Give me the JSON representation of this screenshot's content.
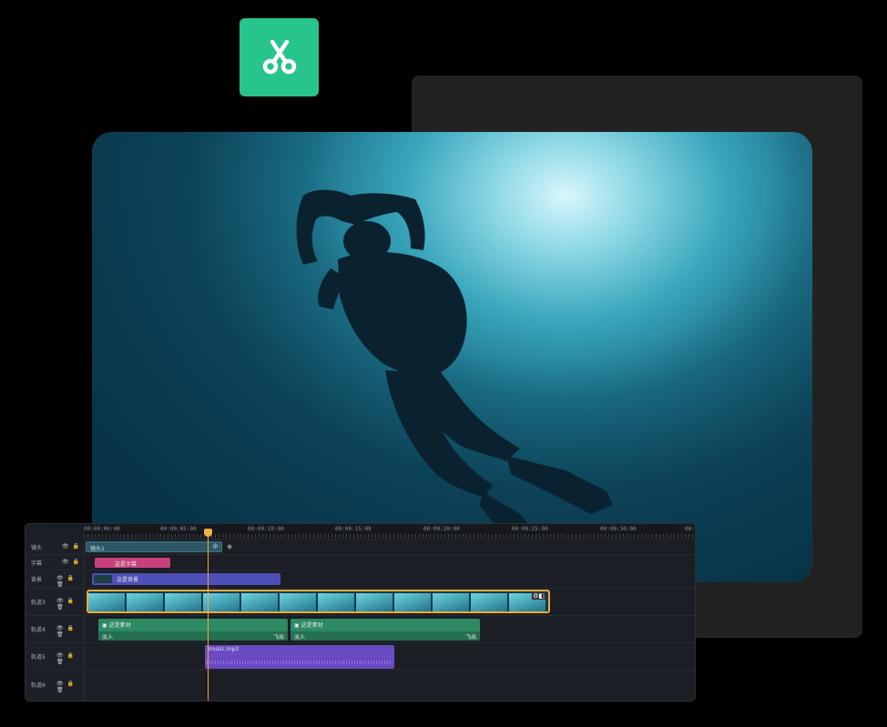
{
  "app": {
    "icon": "scissors-icon",
    "accent": "#27c48c"
  },
  "ruler": {
    "labels": [
      "00:00:00:00",
      "00:00:05:00",
      "00:00:10:00",
      "00:00:15:00",
      "00:00:20:00",
      "00:00:25:00",
      "00:00:30:00",
      "00:"
    ]
  },
  "tracks": [
    {
      "name": "镜头",
      "icons": "👁 🔒"
    },
    {
      "name": "字幕",
      "icons": "👁 🔒"
    },
    {
      "name": "背景",
      "icons": "👁 🔒 🗑"
    },
    {
      "name": "轨道3",
      "icons": "👁 🔒 🗑"
    },
    {
      "name": "轨道4",
      "icons": "👁 🔒 🗑"
    },
    {
      "name": "轨道5",
      "icons": "👁 🔒 🗑"
    },
    {
      "name": "轨道6",
      "icons": "👁 🔒 🗑"
    }
  ],
  "clips": {
    "camera": "镜头1",
    "subtitle": "这是字幕",
    "background": "这是背景",
    "material1": "这是素材",
    "material2": "这是素材",
    "fade_in": "淡入",
    "fly_out": "飞出",
    "audio": "music.mp3"
  },
  "colors": {
    "playhead": "#f0a93a",
    "subtitle": "#c8407f",
    "background": "#4e4fb8",
    "material": "#2d8a63",
    "audio": "#6a4bc4",
    "video_border": "#f0a93a"
  }
}
